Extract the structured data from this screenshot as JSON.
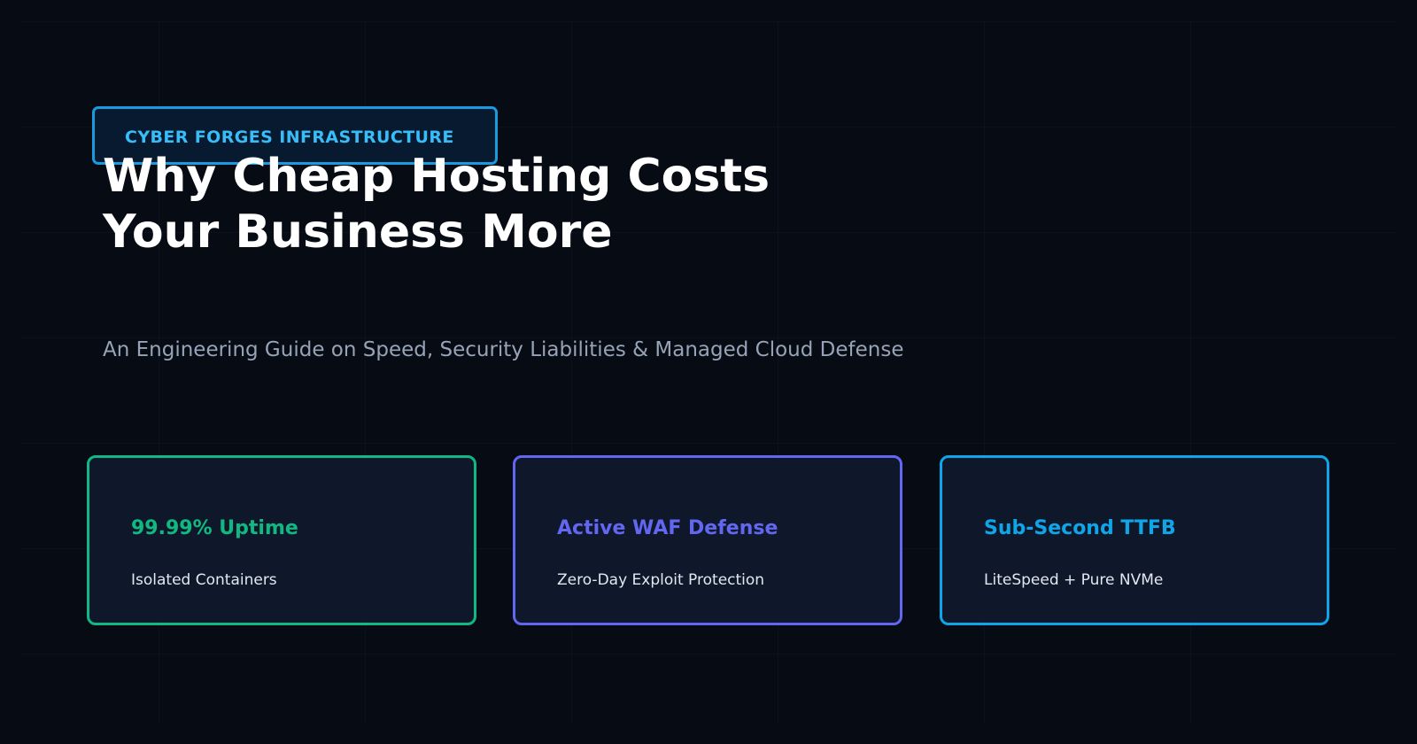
{
  "badge": {
    "label": "CYBER FORGES INFRASTRUCTURE",
    "color": "#38bdf8",
    "border_color": "#1a9be0"
  },
  "hero": {
    "title_line1": "Why Cheap Hosting Costs",
    "title_line2": "Your Business More",
    "subtitle": "An Engineering Guide on Speed, Security Liabilities & Managed Cloud Defense"
  },
  "features": [
    {
      "title": "99.99% Uptime",
      "description": "Isolated Containers",
      "accent": "#10b981"
    },
    {
      "title": "Active WAF Defense",
      "description": "Zero-Day Exploit Protection",
      "accent": "#6366f1"
    },
    {
      "title": "Sub-Second TTFB",
      "description": "LiteSpeed + Pure NVMe",
      "accent": "#0ea5e9"
    }
  ],
  "colors": {
    "background": "#070b14",
    "title": "#ffffff",
    "subtitle": "#97a3b6",
    "card_text": "#e2e8f0"
  }
}
